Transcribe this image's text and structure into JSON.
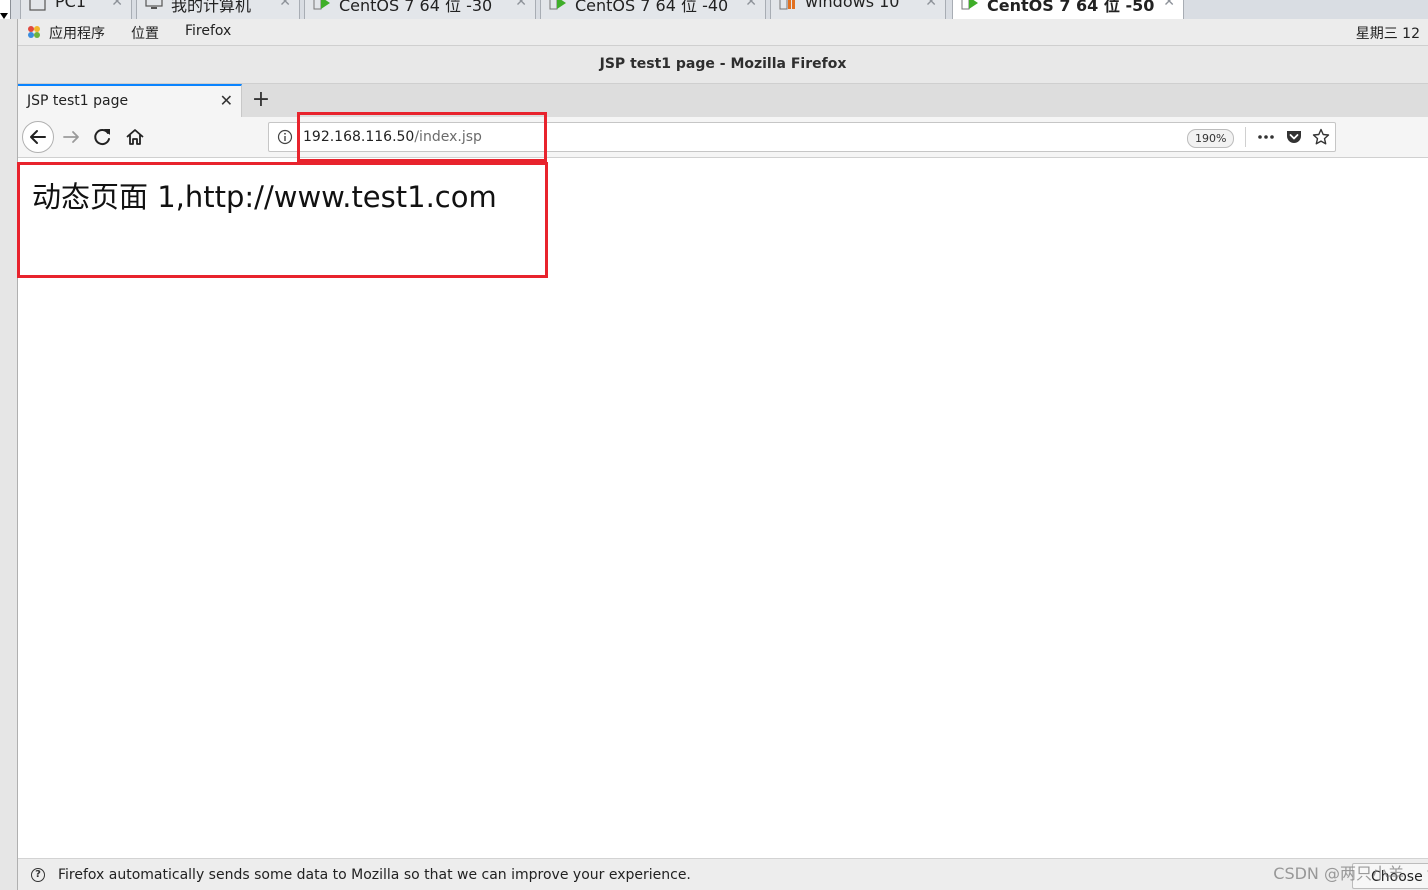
{
  "vm_tabs": [
    {
      "label": "PC1",
      "active": false
    },
    {
      "label": "我的计算机",
      "active": false
    },
    {
      "label": "CentOS 7 64 位 -30",
      "active": false
    },
    {
      "label": "CentOS 7 64 位 -40",
      "active": false
    },
    {
      "label": "windows 10",
      "active": false
    },
    {
      "label": "CentOS 7 64 位 -50",
      "active": true
    }
  ],
  "gnome_bar": {
    "applications": "应用程序",
    "places": "位置",
    "firefox": "Firefox",
    "clock": "星期三 12"
  },
  "window": {
    "title": "JSP test1 page - Mozilla Firefox"
  },
  "browser_tabs": [
    {
      "title": "JSP test1 page"
    }
  ],
  "navbar": {
    "url_host": "192.168.116.50",
    "url_path": "/index.jsp",
    "zoom": "190%"
  },
  "page": {
    "body_text": "动态页面 1,http://www.test1.com"
  },
  "notification": {
    "text": "Firefox automatically sends some data to Mozilla so that we can improve your experience.",
    "choose_button": "Choose W"
  },
  "watermark": "CSDN @两只小羊",
  "colors": {
    "highlight": "#e8232d",
    "tab_accent": "#0a84ff",
    "vm_green": "#3fae29"
  }
}
